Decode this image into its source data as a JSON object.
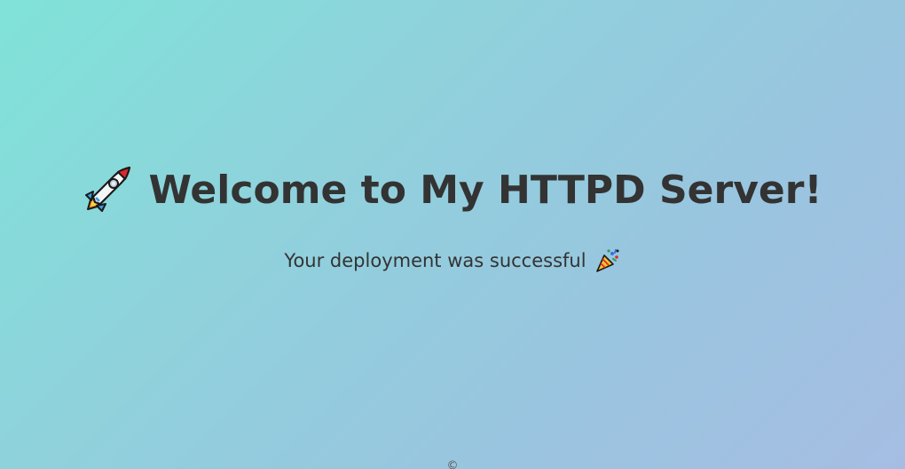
{
  "hero": {
    "title": "Welcome to My HTTPD Server!",
    "subtitle": "Your deployment was successful",
    "title_icon": "rocket-icon",
    "subtitle_icon": "party-popper-icon"
  },
  "footer": {
    "text": "©"
  },
  "colors": {
    "background_start": "#7fe3d8",
    "background_end": "#a6bde3",
    "text": "#333333"
  }
}
